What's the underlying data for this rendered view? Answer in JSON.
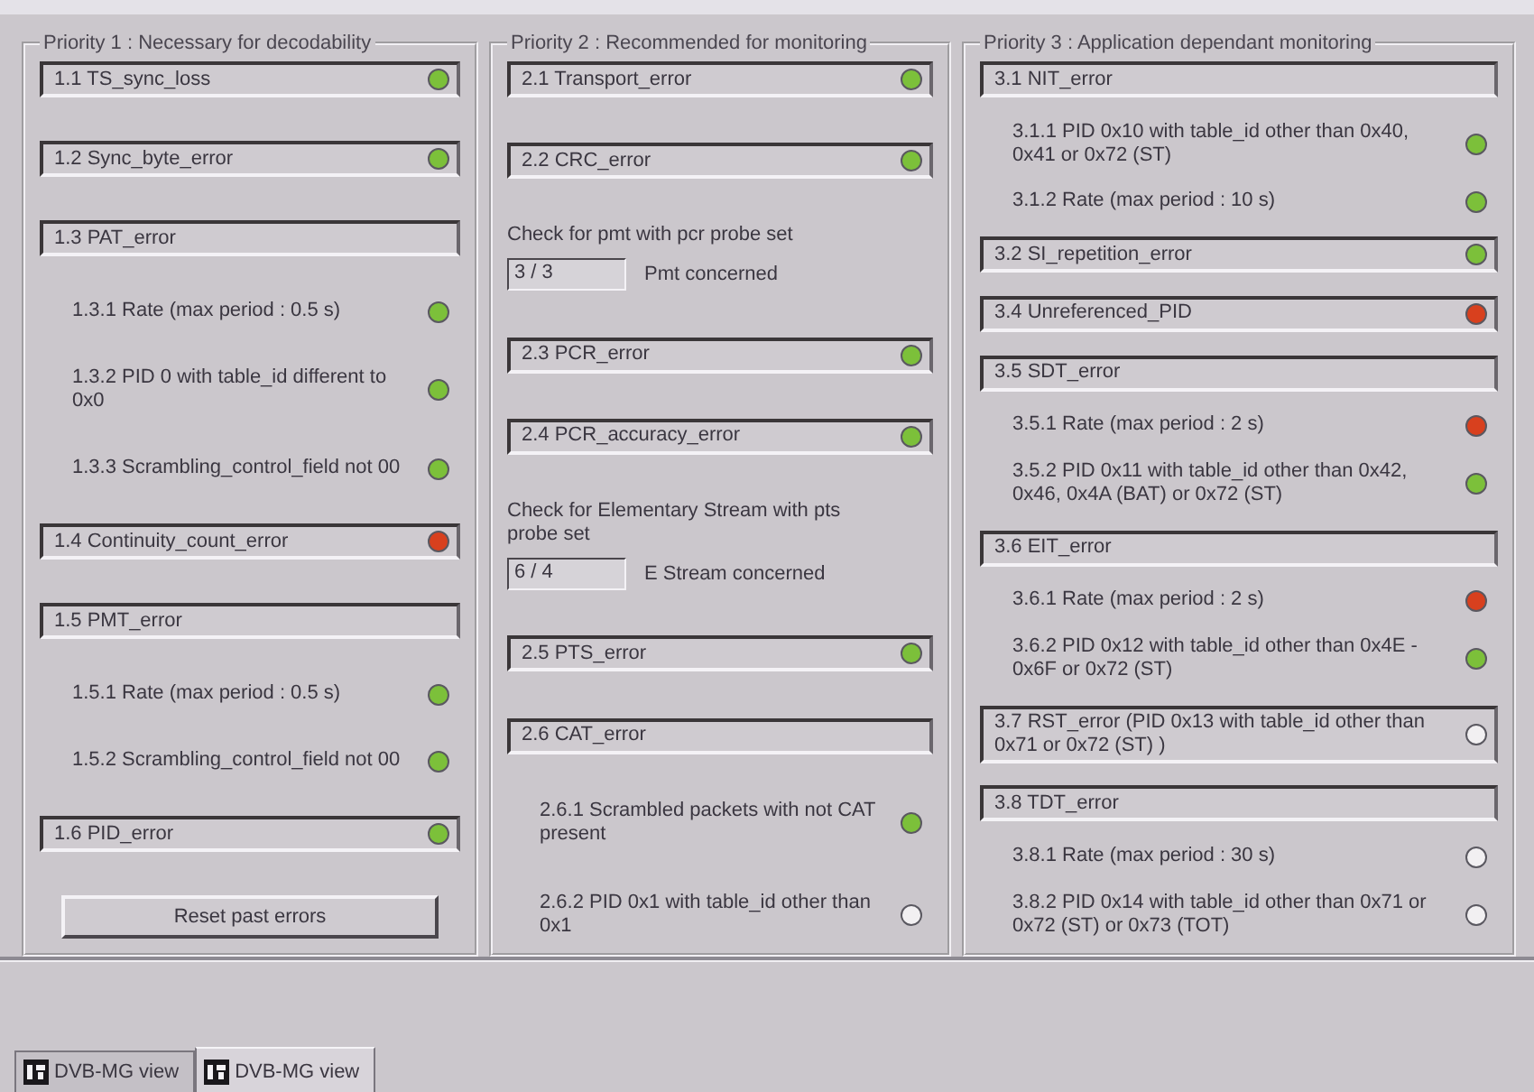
{
  "groups": [
    {
      "title": "Priority 1 : Necessary for decodability",
      "items": [
        {
          "kind": "header",
          "label": "1.1  TS_sync_loss",
          "color": "#7cc03a"
        },
        {
          "kind": "header",
          "label": "1.2  Sync_byte_error",
          "color": "#7cc03a"
        },
        {
          "kind": "header",
          "label": "1.3  PAT_error"
        },
        {
          "kind": "sub",
          "label": "1.3.1  Rate (max period : 0.5 s)",
          "color": "#7cc03a"
        },
        {
          "kind": "sub",
          "label": "1.3.2  PID 0 with table_id different to 0x0",
          "color": "#7cc03a"
        },
        {
          "kind": "sub",
          "label": "1.3.3  Scrambling_control_field not 00",
          "color": "#7cc03a"
        },
        {
          "kind": "header",
          "label": "1.4  Continuity_count_error",
          "color": "#d8401e"
        },
        {
          "kind": "header",
          "label": "1.5  PMT_error"
        },
        {
          "kind": "sub",
          "label": "1.5.1  Rate (max period : 0.5 s)",
          "color": "#7cc03a"
        },
        {
          "kind": "sub",
          "label": "1.5.2  Scrambling_control_field not 00",
          "color": "#7cc03a"
        },
        {
          "kind": "header",
          "label": "1.6  PID_error",
          "color": "#7cc03a"
        },
        {
          "kind": "button",
          "label": "Reset past errors"
        }
      ]
    },
    {
      "title": "Priority 2 : Recommended for monitoring",
      "items": [
        {
          "kind": "header",
          "label": "2.1  Transport_error",
          "color": "#7cc03a"
        },
        {
          "kind": "header",
          "label": "2.2  CRC_error",
          "color": "#7cc03a"
        },
        {
          "kind": "counter",
          "heading": "Check for pmt with pcr probe set",
          "value": "3 / 3",
          "label": "Pmt concerned"
        },
        {
          "kind": "header",
          "label": "2.3  PCR_error",
          "color": "#7cc03a"
        },
        {
          "kind": "header",
          "label": "2.4  PCR_accuracy_error",
          "color": "#7cc03a"
        },
        {
          "kind": "counter",
          "heading": "Check for Elementary Stream with pts probe set",
          "value": "6 / 4",
          "label": "E Stream concerned"
        },
        {
          "kind": "header",
          "label": "2.5  PTS_error",
          "color": "#7cc03a"
        },
        {
          "kind": "header",
          "label": "2.6  CAT_error"
        },
        {
          "kind": "sub",
          "label": "2.6.1  Scrambled packets with not CAT present",
          "color": "#7cc03a"
        },
        {
          "kind": "sub",
          "label": "2.6.2  PID 0x1 with table_id other than 0x1",
          "color": "#f2f0f2"
        }
      ]
    },
    {
      "title": "Priority 3 : Application dependant monitoring",
      "items": [
        {
          "kind": "header",
          "label": "3.1  NIT_error"
        },
        {
          "kind": "sub",
          "label": "3.1.1  PID 0x10 with table_id other than 0x40, 0x41 or 0x72 (ST)",
          "color": "#7cc03a"
        },
        {
          "kind": "sub",
          "label": "3.1.2  Rate (max period : 10 s)",
          "color": "#7cc03a"
        },
        {
          "kind": "header",
          "label": "3.2  SI_repetition_error",
          "color": "#7cc03a"
        },
        {
          "kind": "header",
          "label": "3.4  Unreferenced_PID",
          "color": "#d8401e"
        },
        {
          "kind": "header",
          "label": "3.5  SDT_error"
        },
        {
          "kind": "sub",
          "label": "3.5.1  Rate (max period : 2 s)",
          "color": "#d8401e"
        },
        {
          "kind": "sub",
          "label": "3.5.2  PID 0x11 with table_id other than 0x42, 0x46, 0x4A (BAT) or 0x72 (ST)",
          "color": "#7cc03a"
        },
        {
          "kind": "header",
          "label": "3.6  EIT_error"
        },
        {
          "kind": "sub",
          "label": "3.6.1  Rate (max period : 2 s)",
          "color": "#d8401e"
        },
        {
          "kind": "sub",
          "label": "3.6.2  PID 0x12 with table_id other than 0x4E - 0x6F or 0x72 (ST)",
          "color": "#7cc03a"
        },
        {
          "kind": "header",
          "label": "3.7  RST_error (PID 0x13 with table_id other than 0x71 or 0x72 (ST) )",
          "color": "#f2f0f2"
        },
        {
          "kind": "header",
          "label": "3.8  TDT_error"
        },
        {
          "kind": "sub",
          "label": "3.8.1  Rate (max period : 30 s)",
          "color": "#f2f0f2"
        },
        {
          "kind": "sub",
          "label": "3.8.2  PID 0x14 with table_id other than 0x71 or 0x72 (ST) or 0x73 (TOT)",
          "color": "#f2f0f2"
        }
      ]
    }
  ],
  "tabs": [
    {
      "label": "DVB-MG view",
      "selected": false
    },
    {
      "label": "DVB-MG view",
      "selected": true
    }
  ]
}
